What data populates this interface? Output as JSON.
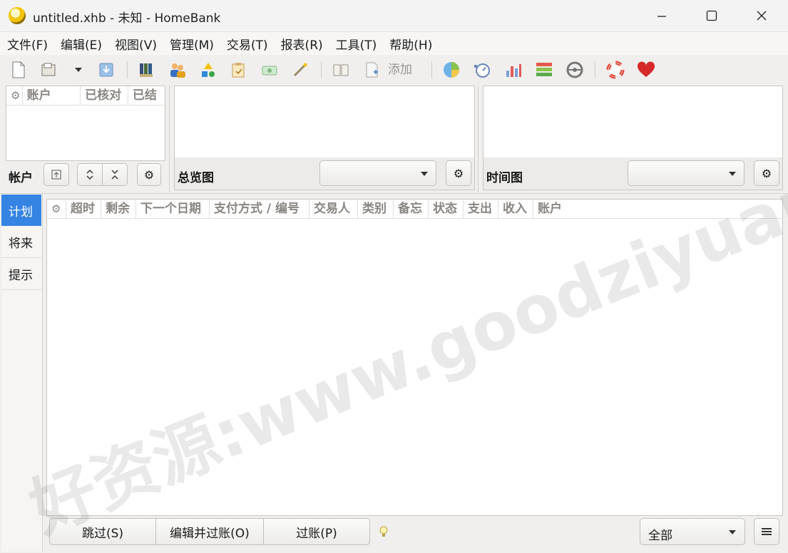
{
  "window": {
    "title": "untitled.xhb - 未知 - HomeBank",
    "min_icon": "minimize-icon",
    "max_icon": "maximize-icon",
    "close_icon": "close-icon"
  },
  "menu": [
    "文件(F)",
    "编辑(E)",
    "视图(V)",
    "管理(M)",
    "交易(T)",
    "报表(R)",
    "工具(T)",
    "帮助(H)"
  ],
  "toolbar": {
    "add_label": "添加"
  },
  "accounts": {
    "columns": [
      "账户",
      "已核对",
      "已结"
    ],
    "footer_label": "帐户"
  },
  "overview": {
    "footer_label": "总览图",
    "combo_value": ""
  },
  "timechart": {
    "footer_label": "时间图",
    "combo_value": ""
  },
  "side_tabs": [
    "计划",
    "将来",
    "提示"
  ],
  "schedule": {
    "columns": [
      "超时",
      "剩余",
      "下一个日期",
      "支付方式 / 编号",
      "交易人",
      "类别",
      "备忘",
      "状态",
      "支出",
      "收入",
      "账户"
    ],
    "skip_label": "跳过(S)",
    "edit_post_label": "编辑并过账(O)",
    "post_label": "过账(P)",
    "filter_value": "全部"
  },
  "watermark": "好资源:www.goodziyuan.com",
  "colors": {
    "selected_tab": "#3584e4",
    "selected_tab_text": "#ffffff"
  }
}
